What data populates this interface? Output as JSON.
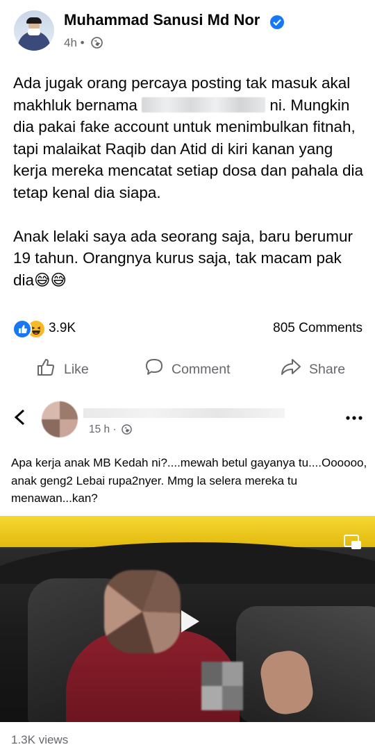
{
  "post": {
    "author": "Muhammad Sanusi Md Nor",
    "time": "4h",
    "paragraph1_before": "Ada jugak orang percaya posting tak masuk akal makhluk bernama",
    "paragraph1_after": "ni. Mungkin dia pakai fake account untuk menimbulkan fitnah, tapi malaikat Raqib dan Atid di kiri kanan yang kerja mereka mencatat setiap dosa dan pahala dia tetap kenal dia siapa.",
    "paragraph2": "Anak lelaki saya ada seorang saja, baru berumur 19 tahun. Orangnya kurus saja, tak macam pak dia😅😅",
    "reaction_count": "3.9K",
    "comments": "805 Comments",
    "actions": {
      "like": "Like",
      "comment": "Comment",
      "share": "Share"
    }
  },
  "shared_post": {
    "time": "15 h",
    "text": "Apa kerja anak MB Kedah ni?....mewah betul gayanya tu....Oooooo, anak geng2 Lebai rupa2nyer. Mmg la selera mereka tu menawan...kan?",
    "views": "1.3K views"
  },
  "colors": {
    "accent": "#1877f2",
    "secondary_text": "#65676b",
    "haha": "#f7b928"
  },
  "icons": [
    "verified-badge-icon",
    "globe-icon",
    "like-icon",
    "comment-icon",
    "share-icon",
    "back-arrow-icon",
    "more-icon",
    "play-icon",
    "picture-in-picture-icon",
    "like-reaction-icon",
    "haha-reaction-icon"
  ]
}
